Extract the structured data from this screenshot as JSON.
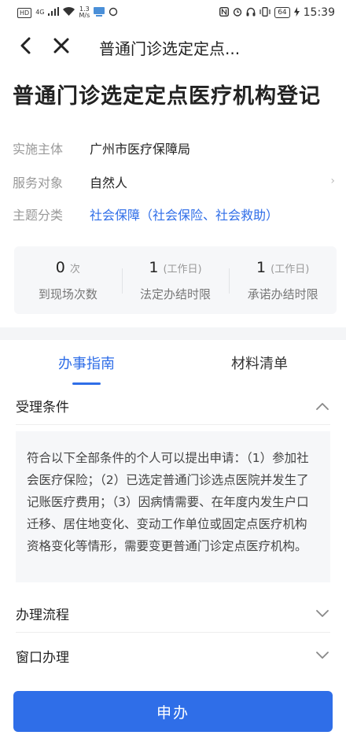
{
  "status_bar": {
    "left_chip": "HD",
    "network_gen": "4G",
    "speed_value": "1.3",
    "speed_unit": "M/s",
    "battery": "64",
    "time": "15:39"
  },
  "nav": {
    "title": "普通门诊选定定点..."
  },
  "page_title": "普通门诊选定定点医疗机构登记",
  "info": {
    "rows": [
      {
        "label": "实施主体",
        "value": "广州市医疗保障局"
      },
      {
        "label": "服务对象",
        "value": "自然人"
      },
      {
        "label": "主题分类",
        "value": "社会保障（社会保险、社会救助）"
      }
    ]
  },
  "stats": [
    {
      "number": "0",
      "unit": "次",
      "label": "到现场次数"
    },
    {
      "number": "1",
      "unit": "(工作日)",
      "label": "法定办结时限"
    },
    {
      "number": "1",
      "unit": "(工作日)",
      "label": "承诺办结时限"
    }
  ],
  "tabs": [
    {
      "label": "办事指南",
      "active": true
    },
    {
      "label": "材料清单",
      "active": false
    }
  ],
  "sections": [
    {
      "title": "受理条件",
      "expanded": true
    },
    {
      "title": "办理流程",
      "expanded": false
    },
    {
      "title": "窗口办理",
      "expanded": false
    }
  ],
  "acceptance_conditions": "符合以下全部条件的个人可以提出申请：（1）参加社会医疗保险；（2）已选定普通门诊选点医院并发生了记账医疗费用；（3）因病情需要、在年度内发生户口迁移、居住地变化、变动工作单位或固定点医疗机构资格变化等情形，需要变更普通门诊定点医疗机构。",
  "apply_button": "申办",
  "colors": {
    "accent": "#2f6ee8",
    "label_gray": "#999999",
    "panel_bg": "#f6f7f9"
  }
}
